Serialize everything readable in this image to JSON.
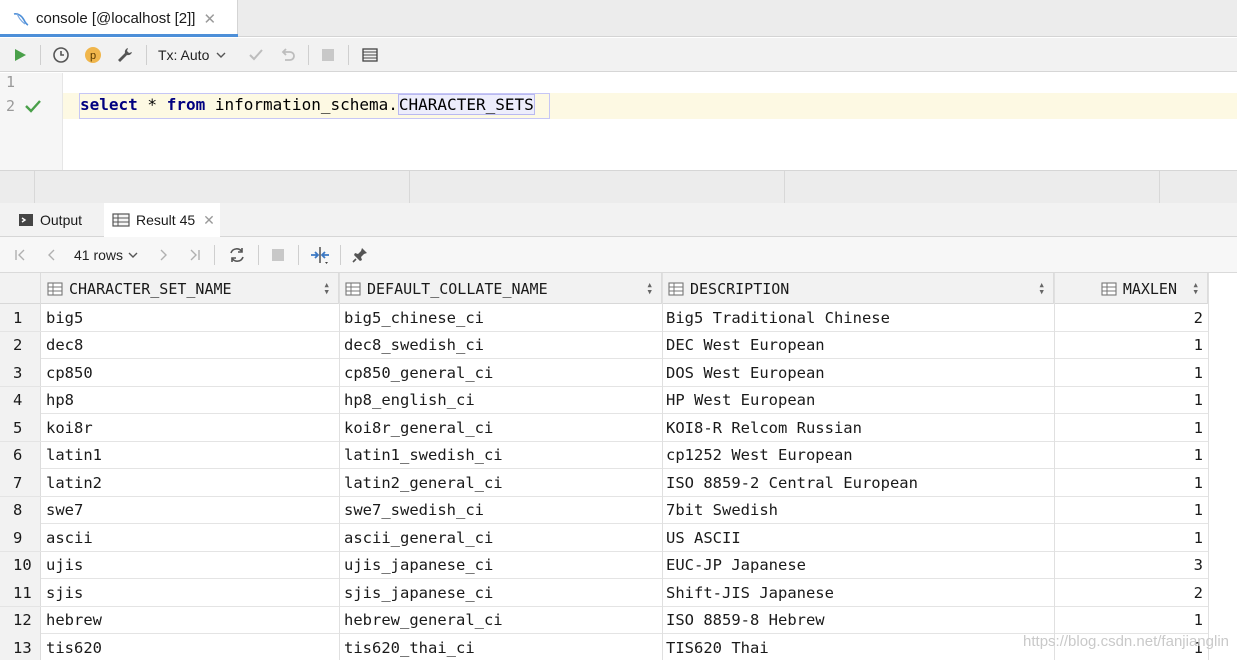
{
  "tab": {
    "title": "console [@localhost [2]]",
    "close": "✕"
  },
  "toolbar": {
    "tx_mode": "Tx: Auto"
  },
  "editor": {
    "line1": "1",
    "line2": "2",
    "kw_select": "select",
    "star": " * ",
    "kw_from": "from",
    "schema": " information_schema.",
    "table": "CHARACTER_SETS"
  },
  "results": {
    "tabs": {
      "output": "Output",
      "result": "Result 45",
      "close": "✕"
    },
    "rows_label": "41 rows",
    "columns": [
      "CHARACTER_SET_NAME",
      "DEFAULT_COLLATE_NAME",
      "DESCRIPTION",
      "MAXLEN"
    ],
    "rows": [
      [
        "1",
        "big5",
        "big5_chinese_ci",
        "Big5 Traditional Chinese",
        "2"
      ],
      [
        "2",
        "dec8",
        "dec8_swedish_ci",
        "DEC West European",
        "1"
      ],
      [
        "3",
        "cp850",
        "cp850_general_ci",
        "DOS West European",
        "1"
      ],
      [
        "4",
        "hp8",
        "hp8_english_ci",
        "HP West European",
        "1"
      ],
      [
        "5",
        "koi8r",
        "koi8r_general_ci",
        "KOI8-R Relcom Russian",
        "1"
      ],
      [
        "6",
        "latin1",
        "latin1_swedish_ci",
        "cp1252 West European",
        "1"
      ],
      [
        "7",
        "latin2",
        "latin2_general_ci",
        "ISO 8859-2 Central European",
        "1"
      ],
      [
        "8",
        "swe7",
        "swe7_swedish_ci",
        "7bit Swedish",
        "1"
      ],
      [
        "9",
        "ascii",
        "ascii_general_ci",
        "US ASCII",
        "1"
      ],
      [
        "10",
        "ujis",
        "ujis_japanese_ci",
        "EUC-JP Japanese",
        "3"
      ],
      [
        "11",
        "sjis",
        "sjis_japanese_ci",
        "Shift-JIS Japanese",
        "2"
      ],
      [
        "12",
        "hebrew",
        "hebrew_general_ci",
        "ISO 8859-8 Hebrew",
        "1"
      ],
      [
        "13",
        "tis620",
        "tis620_thai_ci",
        "TIS620 Thai",
        "1"
      ]
    ]
  },
  "watermark": "https://blog.csdn.net/fanjianglin",
  "colors": {
    "accent": "#4d8fd8",
    "run_green": "#4aa04a",
    "keyword": "#000080"
  }
}
